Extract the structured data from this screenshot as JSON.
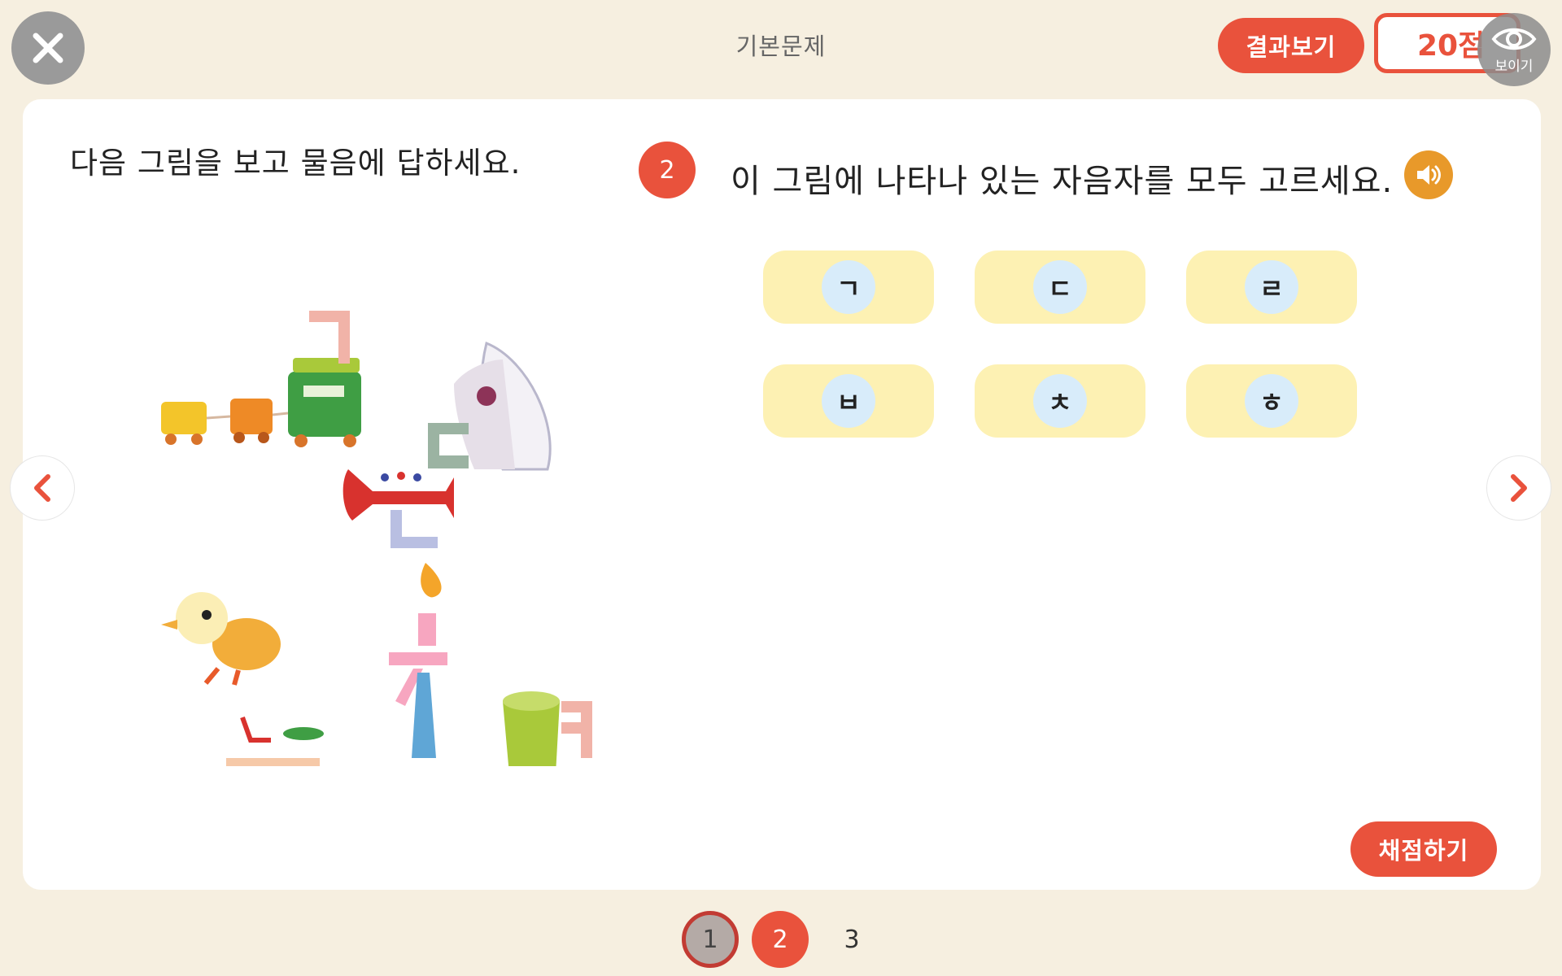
{
  "header": {
    "title": "기본문제",
    "result_label": "결과보기",
    "score": "20점",
    "show_label": "보이기"
  },
  "instruction": "다음 그림을 보고 물음에 답하세요.",
  "question": {
    "number": "2",
    "text": "이 그림에 나타나 있는 자음자를 모두 고르세요."
  },
  "choices": [
    "ㄱ",
    "ㄷ",
    "ㄹ",
    "ㅂ",
    "ㅊ",
    "ㅎ"
  ],
  "grade_label": "채점하기",
  "pagination": {
    "pages": [
      "1",
      "2",
      "3"
    ],
    "current": "2"
  },
  "icons": {
    "close": "close-icon",
    "eye": "eye-icon",
    "sound": "speaker-icon",
    "prev": "chevron-left-icon",
    "next": "chevron-right-icon"
  },
  "colors": {
    "accent": "#e9523c",
    "background": "#f6efe0",
    "choice_bg": "#fdf1b3",
    "choice_circle": "#d8ecfa",
    "sound": "#e8992a"
  }
}
